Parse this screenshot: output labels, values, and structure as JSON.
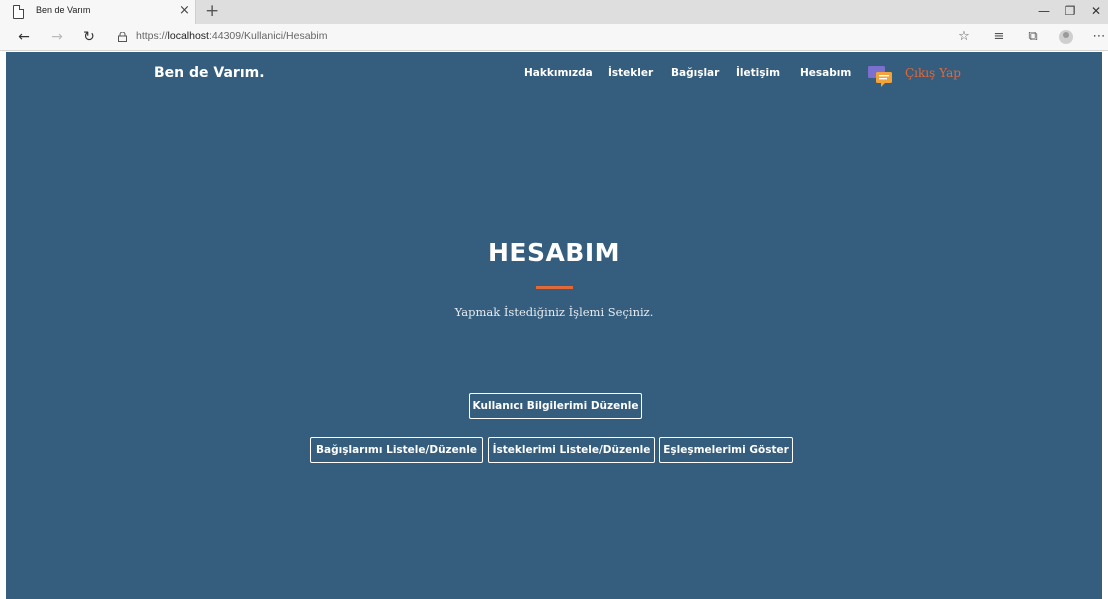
{
  "browser": {
    "tab_title": "Ben de Varım",
    "tab_close": "×",
    "new_tab": "+",
    "window_controls": {
      "minimize": "—",
      "maximize": "❐",
      "close": "✕"
    },
    "url_prefix": "https://",
    "url_host": "localhost",
    "url_rest": ":44309/Kullanici/Hesabim",
    "toolbar_icons": [
      "favorite-star-icon",
      "favorites-list-icon",
      "collections-icon",
      "profile-avatar-icon",
      "more-menu-icon"
    ]
  },
  "navbar": {
    "brand": "Ben de Varım.",
    "links": [
      "Hakkımızda",
      "İstekler",
      "Bağışlar",
      "İletişim",
      "Hesabım"
    ],
    "logout": "Çıkış Yap"
  },
  "hero": {
    "title": "HESABIM",
    "subtitle": "Yapmak İstediğiniz İşlemi Seçiniz."
  },
  "actions": {
    "edit_profile": "Kullanıcı Bilgilerimi Düzenle",
    "list_donations": "Bağışlarımı Listele/Düzenle",
    "list_requests": "İsteklerimi Listele/Düzenle",
    "show_matches": "Eşleşmelerimi Göster"
  },
  "colors": {
    "page_background": "#355d7e",
    "accent": "#e0693a",
    "text": "#ffffff"
  }
}
